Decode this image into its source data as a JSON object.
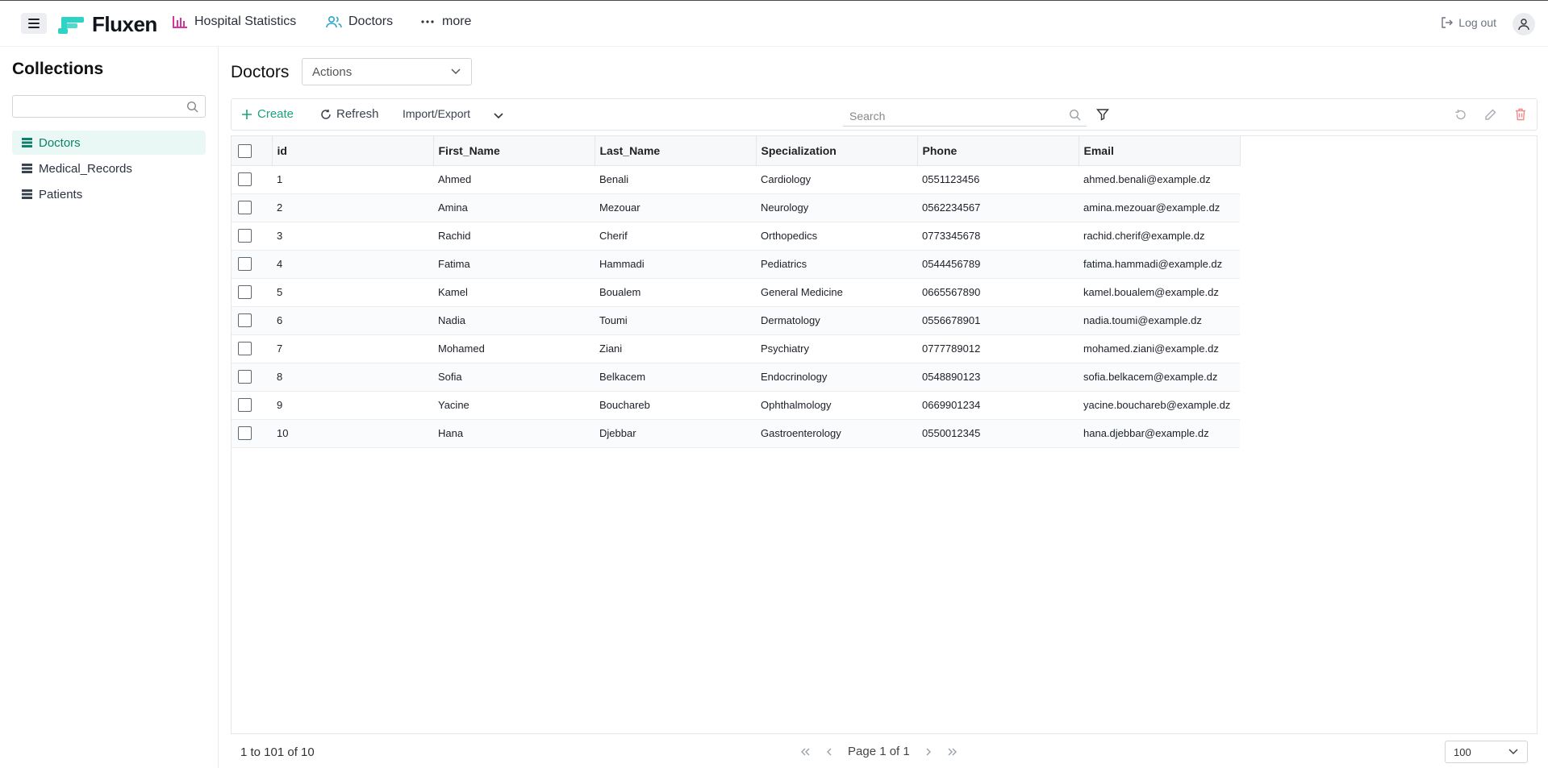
{
  "app": {
    "name": "Fluxen"
  },
  "nav": {
    "links": [
      {
        "label": "Hospital Statistics",
        "icon": "bar-chart-icon"
      },
      {
        "label": "Doctors",
        "icon": "users-icon"
      },
      {
        "label": "more",
        "icon": "dots-icon"
      }
    ],
    "logout_label": "Log out"
  },
  "sidebar": {
    "title": "Collections",
    "search_placeholder": "",
    "items": [
      {
        "label": "Doctors",
        "active": true
      },
      {
        "label": "Medical_Records",
        "active": false
      },
      {
        "label": "Patients",
        "active": false
      }
    ]
  },
  "main": {
    "title": "Doctors",
    "actions_label": "Actions"
  },
  "toolbar": {
    "create_label": "Create",
    "refresh_label": "Refresh",
    "import_export_label": "Import/Export",
    "search_placeholder": "Search"
  },
  "table": {
    "columns": [
      "id",
      "First_Name",
      "Last_Name",
      "Specialization",
      "Phone",
      "Email"
    ],
    "rows": [
      [
        "1",
        "Ahmed",
        "Benali",
        "Cardiology",
        "0551123456",
        "ahmed.benali@example.dz"
      ],
      [
        "2",
        "Amina",
        "Mezouar",
        "Neurology",
        "0562234567",
        "amina.mezouar@example.dz"
      ],
      [
        "3",
        "Rachid",
        "Cherif",
        "Orthopedics",
        "0773345678",
        "rachid.cherif@example.dz"
      ],
      [
        "4",
        "Fatima",
        "Hammadi",
        "Pediatrics",
        "0544456789",
        "fatima.hammadi@example.dz"
      ],
      [
        "5",
        "Kamel",
        "Boualem",
        "General Medicine",
        "0665567890",
        "kamel.boualem@example.dz"
      ],
      [
        "6",
        "Nadia",
        "Toumi",
        "Dermatology",
        "0556678901",
        "nadia.toumi@example.dz"
      ],
      [
        "7",
        "Mohamed",
        "Ziani",
        "Psychiatry",
        "0777789012",
        "mohamed.ziani@example.dz"
      ],
      [
        "8",
        "Sofia",
        "Belkacem",
        "Endocrinology",
        "0548890123",
        "sofia.belkacem@example.dz"
      ],
      [
        "9",
        "Yacine",
        "Bouchareb",
        "Ophthalmology",
        "0669901234",
        "yacine.bouchareb@example.dz"
      ],
      [
        "10",
        "Hana",
        "Djebbar",
        "Gastroenterology",
        "0550012345",
        "hana.djebbar@example.dz"
      ]
    ]
  },
  "footer": {
    "count_text": "1 to 101 of 10",
    "page_text": "Page 1 of 1",
    "page_size": "100"
  },
  "colors": {
    "brand": "#2fd3c6",
    "accent_green": "#1aa37c",
    "active_bg": "#e9f8f4",
    "delete_red": "#e05252",
    "chart_pink": "#d6369a"
  }
}
